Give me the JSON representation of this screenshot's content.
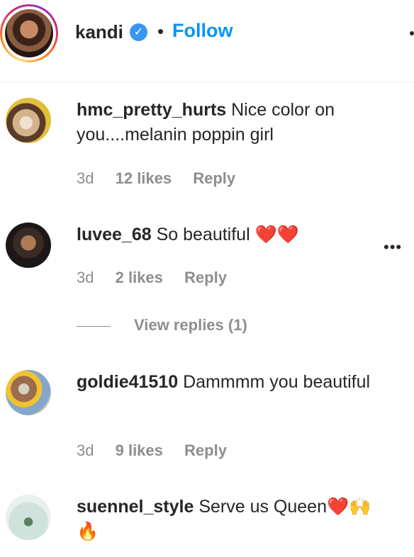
{
  "post_header": {
    "username": "kandi",
    "verified_icon": "verified-badge-icon",
    "separator": "•",
    "follow_label": "Follow"
  },
  "comments": [
    {
      "username": "hmc_pretty_hurts",
      "text": "Nice color on you....melanin poppin girl",
      "age": "3d",
      "likes": "12 likes",
      "reply": "Reply"
    },
    {
      "username": "luvee_68",
      "text": "So beautiful ❤️❤️",
      "age": "3d",
      "likes": "2 likes",
      "reply": "Reply",
      "more": "•••"
    },
    {
      "username": "goldie41510",
      "text": "Dammmm you beautiful",
      "age": "3d",
      "likes": "9 likes",
      "reply": "Reply"
    },
    {
      "username": "suennel_style",
      "text": "Serve us Queen❤️🙌🔥"
    }
  ],
  "view_replies_label": "View replies (1)"
}
